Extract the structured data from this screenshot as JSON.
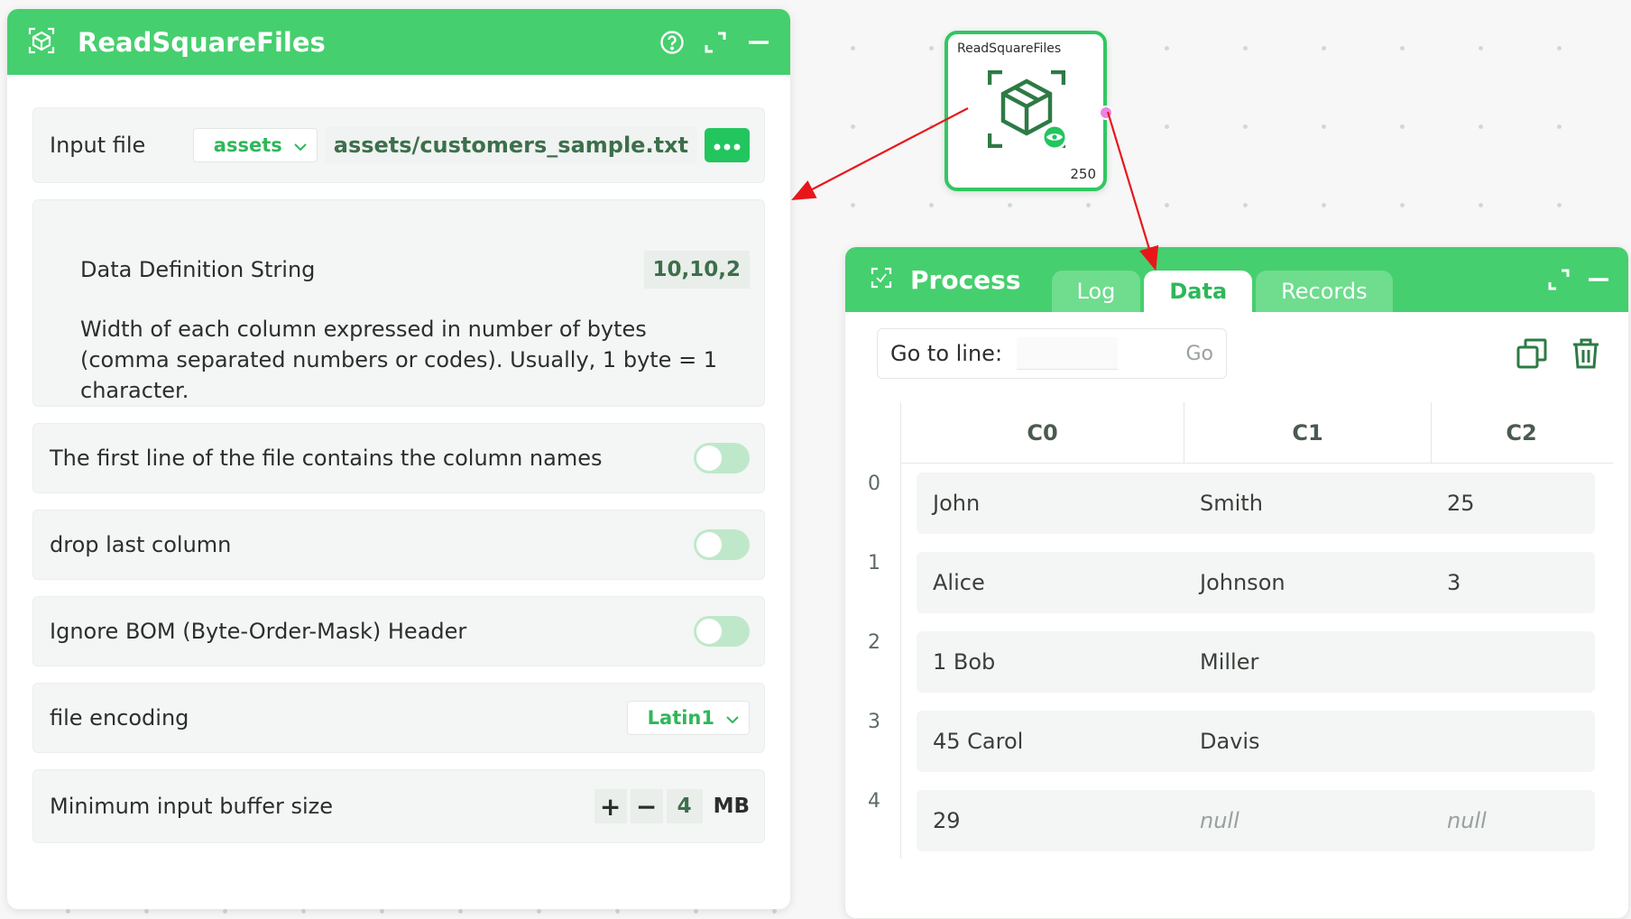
{
  "config": {
    "title": "ReadSquareFiles",
    "input_file": {
      "label": "Input file",
      "source": "assets",
      "path": "assets/customers_sample.txt"
    },
    "data_definition": {
      "label": "Data Definition String",
      "value": "10,10,2",
      "description": "Width of each column expressed in number of bytes (comma separated numbers or codes). Usually, 1 byte = 1 character."
    },
    "first_line_header": {
      "label": "The first line of the file contains the column names",
      "enabled": false
    },
    "drop_last_column": {
      "label": "drop last column",
      "enabled": false
    },
    "ignore_bom": {
      "label": "Ignore BOM (Byte-Order-Mask) Header",
      "enabled": false
    },
    "file_encoding": {
      "label": "file encoding",
      "value": "Latin1"
    },
    "buffer_size": {
      "label": "Minimum input buffer size",
      "plus": "+",
      "minus": "−",
      "value": "4",
      "unit": "MB"
    }
  },
  "node": {
    "title": "ReadSquareFiles",
    "count": "250"
  },
  "process": {
    "title": "Process",
    "tabs": [
      "Log",
      "Data",
      "Records"
    ],
    "active_tab": "Data",
    "goto": {
      "label": "Go to line:",
      "button": "Go",
      "value": ""
    },
    "columns": [
      "C0",
      "C1",
      "C2"
    ],
    "rows": [
      {
        "index": "0",
        "c0": "John",
        "c1": "Smith",
        "c2": "25"
      },
      {
        "index": "1",
        "c0": "Alice",
        "c1": "Johnson",
        "c2": "3"
      },
      {
        "index": "2",
        "c0": "1 Bob",
        "c1": "Miller",
        "c2": ""
      },
      {
        "index": "3",
        "c0": "45 Carol",
        "c1": "Davis",
        "c2": ""
      },
      {
        "index": "4",
        "c0": "29",
        "c1": "null",
        "c2": "null"
      }
    ]
  },
  "colors": {
    "header_green": "#46cf6e",
    "accent_green": "#22c55e",
    "port_pink": "#ee82e6",
    "arrow_red": "#e8161b"
  }
}
